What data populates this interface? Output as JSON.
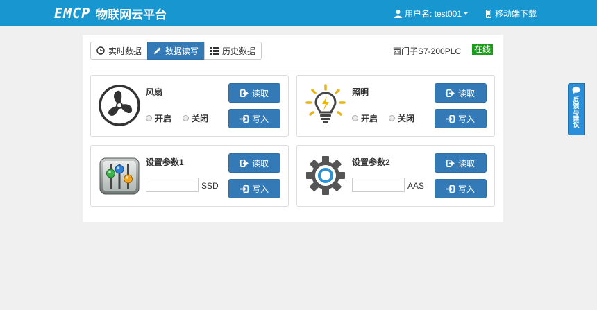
{
  "header": {
    "logo_text": "EMCP",
    "platform_name": "物联网云平台",
    "user_label": "用户名: test001",
    "mobile_download": "移动端下载"
  },
  "tabs": [
    {
      "label": "实时数据",
      "icon": "clock-icon",
      "active": false
    },
    {
      "label": "数据读写",
      "icon": "pencil-icon",
      "active": true
    },
    {
      "label": "历史数据",
      "icon": "list-icon",
      "active": false
    }
  ],
  "device": {
    "name": "西门子S7-200PLC",
    "status": "在线"
  },
  "cards": [
    {
      "title": "风扇",
      "icon": "fan-icon",
      "read_label": "读取",
      "write_label": "写入",
      "options": [
        "开启",
        "关闭"
      ]
    },
    {
      "title": "照明",
      "icon": "lightbulb-icon",
      "read_label": "读取",
      "write_label": "写入",
      "options": [
        "开启",
        "关闭"
      ]
    },
    {
      "title": "设置参数1",
      "icon": "mixer-icon",
      "read_label": "读取",
      "write_label": "写入",
      "input_value": "",
      "unit": "SSD"
    },
    {
      "title": "设置参数2",
      "icon": "gear-icon",
      "read_label": "读取",
      "write_label": "写入",
      "input_value": "",
      "unit": "AAS"
    }
  ],
  "feedback": {
    "label": "反馈与建议",
    "icon": "chat-icon"
  },
  "colors": {
    "header_bg": "#1796cf",
    "primary_button": "#337ab7",
    "online_badge": "#1b9c1b",
    "feedback_bg": "#2a8fd8"
  }
}
